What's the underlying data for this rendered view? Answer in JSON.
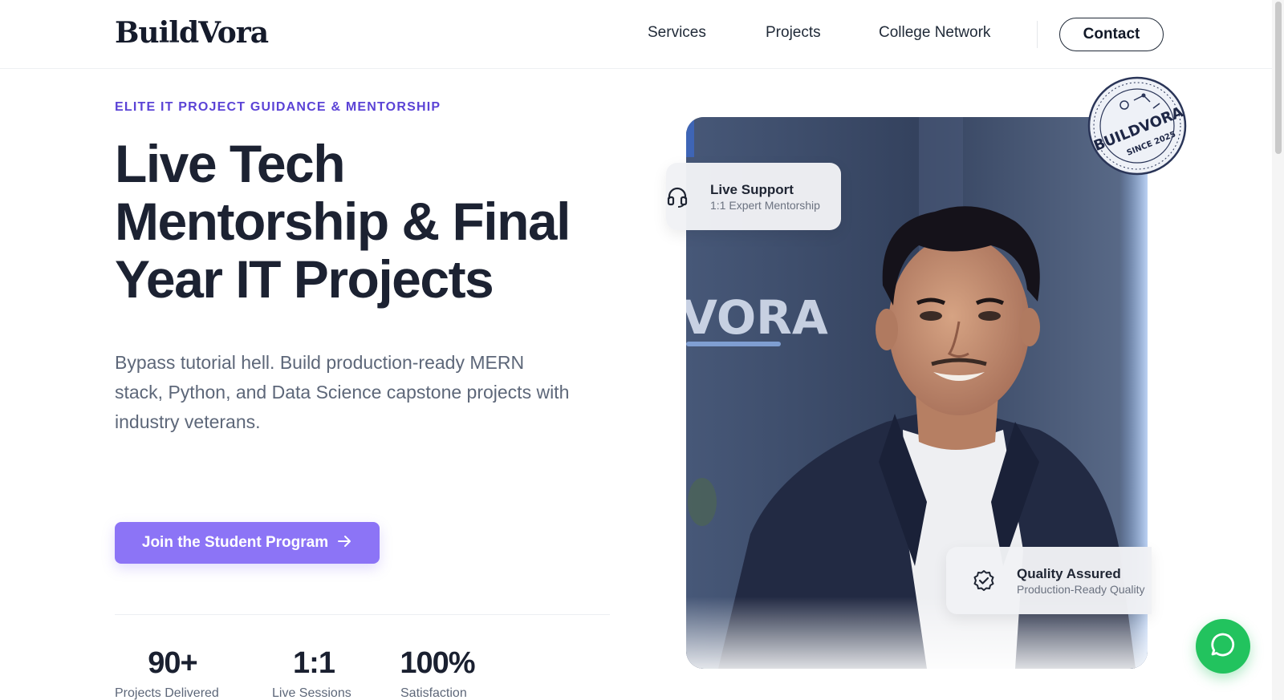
{
  "brand": {
    "name": "BuildVora"
  },
  "nav": {
    "items": [
      "Services",
      "Projects",
      "College Network"
    ],
    "contact_label": "Contact"
  },
  "hero": {
    "eyebrow": "ELITE IT PROJECT GUIDANCE & MENTORSHIP",
    "headline_lines": [
      "Live Tech",
      "Mentorship & Final",
      "Year IT Projects"
    ],
    "lead": "Bypass tutorial hell. Build production-ready MERN stack, Python, and Data Science capstone projects with industry veterans.",
    "cta_label": "Join the Student Program",
    "cta_icon": "arrow-right-icon"
  },
  "stats": [
    {
      "value": "90+",
      "label": "Projects Delivered"
    },
    {
      "value": "1:1",
      "label": "Live Sessions"
    },
    {
      "value": "100%",
      "label": "Satisfaction"
    }
  ],
  "cards": {
    "support": {
      "title": "Live Support",
      "subtitle": "1:1 Expert Mentorship",
      "icon": "headset-icon"
    },
    "quality": {
      "title": "Quality Assured",
      "subtitle": "Production-Ready Quality",
      "icon": "verified-badge-icon"
    }
  },
  "stamp": {
    "text_top": "BUILDVORA",
    "text_bottom": "SINCE 2025"
  },
  "photo_background_text": "VORA",
  "chat": {
    "icon": "chat-bubble-icon"
  },
  "colors": {
    "accent": "#5b43d6",
    "cta": "#8c74f6",
    "chat": "#22c35e",
    "text_dark": "#1c2232",
    "text_muted": "#5d6779"
  }
}
